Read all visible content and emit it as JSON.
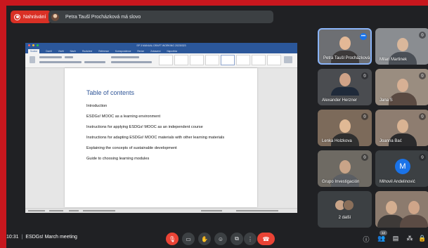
{
  "recording": {
    "label": "Nahrávání"
  },
  "speaker_banner": {
    "text": "Petra Taušl Procházková má slovo"
  },
  "document": {
    "window_title": "SP 3 MANUAL DRAFT WORKING 20230323",
    "ribbon_tabs": [
      "Soubor",
      "Domů",
      "Vložit",
      "Návrh",
      "Rozložení",
      "Reference",
      "Korespondence",
      "Revize",
      "Zobrazení",
      "Nápověda"
    ],
    "toc_title": "Table of contents",
    "toc_entries": [
      "Introduction",
      "ESDGs! MOOC as a learning environment",
      "Instructions for applying ESDGs! MOOC as an independent course",
      "Instructions for adapting ESDGs! MOOC materials with other learning materials",
      "Explaining the concepts of sustainable development",
      "Guide to choosing learning modules"
    ]
  },
  "participants": [
    {
      "name": "Petra Taušl Procházková",
      "muted": false
    },
    {
      "name": "Milan Martinek",
      "muted": true
    },
    {
      "name": "Alexander Herzner",
      "muted": true
    },
    {
      "name": "Jana S",
      "muted": true
    },
    {
      "name": "Lenka Holzkova",
      "muted": true
    },
    {
      "name": "Joanna Bać",
      "muted": true
    },
    {
      "name": "Grupo Investigación",
      "muted": true
    },
    {
      "name": "Mihovil Andelinović",
      "muted": true,
      "initial": "M",
      "color": "#1a73e8"
    },
    {
      "name": "2 další",
      "muted": false
    }
  ],
  "meeting": {
    "time": "10:31",
    "title": "ESDGs! March meeting",
    "people_count": "12"
  },
  "colors": {
    "frame": "#c8171e",
    "background": "#202124",
    "leave_button": "#ea4335",
    "word_blue": "#2b579a"
  }
}
